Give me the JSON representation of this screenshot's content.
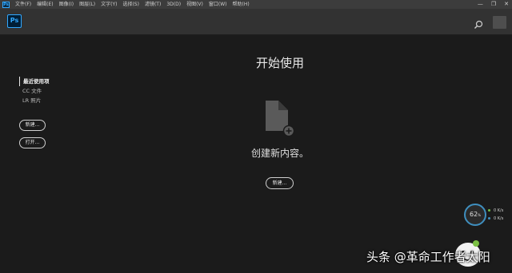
{
  "menubar": {
    "app_icon": "Ps",
    "items": [
      "文件(F)",
      "编辑(E)",
      "图像(I)",
      "图层(L)",
      "文字(Y)",
      "选择(S)",
      "滤镜(T)",
      "3D(D)",
      "视图(V)",
      "窗口(W)",
      "帮助(H)"
    ],
    "window_controls": [
      "—",
      "❐",
      "✕"
    ]
  },
  "header": {
    "logo_text": "Ps",
    "search_icon": "search-icon"
  },
  "sidebar": {
    "items": [
      {
        "label": "最近使用项",
        "active": true
      },
      {
        "label": "CC 文件",
        "active": false
      },
      {
        "label": "LR 照片",
        "active": false
      }
    ],
    "new_button": "新建...",
    "open_button": "打开..."
  },
  "main": {
    "title": "开始使用",
    "empty_icon": "new-document-icon",
    "empty_text": "创建新内容。",
    "new_button": "新建..."
  },
  "perf_widget": {
    "value": "62",
    "unit": "%",
    "stat1": "0",
    "stat1_unit": "K/s",
    "stat2": "0",
    "stat2_unit": "K/s"
  },
  "watermark": {
    "text": "头条 @革命工作者太阳"
  },
  "colors": {
    "accent": "#31a8ff",
    "background": "#1b1b1b",
    "menubar": "#3c3c3c",
    "header": "#323232"
  }
}
